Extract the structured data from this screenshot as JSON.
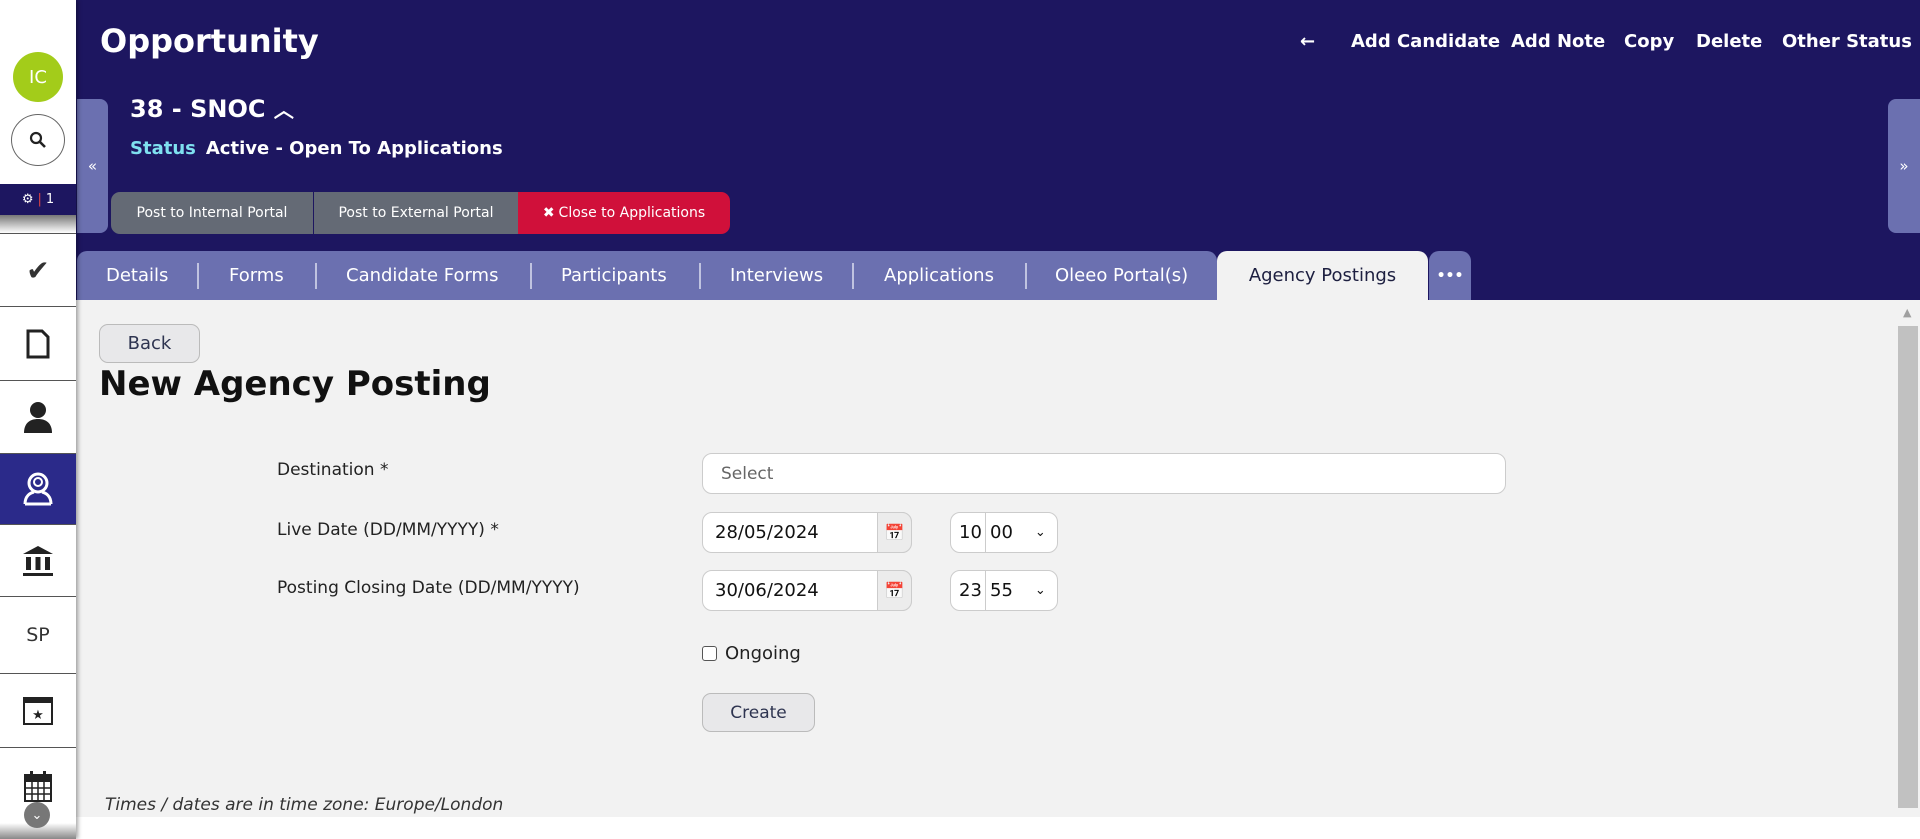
{
  "sidebar": {
    "avatar_initials": "IC",
    "badge_count": "1",
    "items": [
      {
        "icon": "check-icon"
      },
      {
        "icon": "document-icon"
      },
      {
        "icon": "person-icon"
      },
      {
        "icon": "person-search-icon",
        "active": true
      },
      {
        "icon": "bank-icon"
      },
      {
        "label": "SP"
      },
      {
        "icon": "calendar-star-icon"
      },
      {
        "icon": "calendar-icon"
      }
    ]
  },
  "header": {
    "title": "Opportunity",
    "actions": [
      "Add Candidate",
      "Add Note",
      "Copy",
      "Delete",
      "Other Status"
    ],
    "record": "38 - SNOC",
    "status_label": "Status",
    "status_value": "Active - Open To Applications",
    "buttons": {
      "internal": "Post to Internal Portal",
      "external": "Post to External Portal",
      "close": "Close to Applications"
    }
  },
  "tabs": [
    "Details",
    "Forms",
    "Candidate Forms",
    "Participants",
    "Interviews",
    "Applications",
    "Oleeo Portal(s)"
  ],
  "active_tab": "Agency Postings",
  "more_tab": "•••",
  "form": {
    "back": "Back",
    "title": "New Agency Posting",
    "destination_label": "Destination *",
    "destination_placeholder": "Select",
    "live_label": "Live Date (DD/MM/YYYY) *",
    "live_date": "28/05/2024",
    "live_hour": "10",
    "live_minute": "00",
    "closing_label": "Posting Closing Date (DD/MM/YYYY)",
    "closing_date": "30/06/2024",
    "closing_hour": "23",
    "closing_minute": "55",
    "ongoing_label": "Ongoing",
    "create": "Create",
    "tz_note": "Times / dates are in time zone: Europe/London"
  },
  "colors": {
    "header": "#1d1660",
    "tab": "#6b70b0",
    "danger": "#d0103a",
    "avatar": "#a3cc1a"
  }
}
